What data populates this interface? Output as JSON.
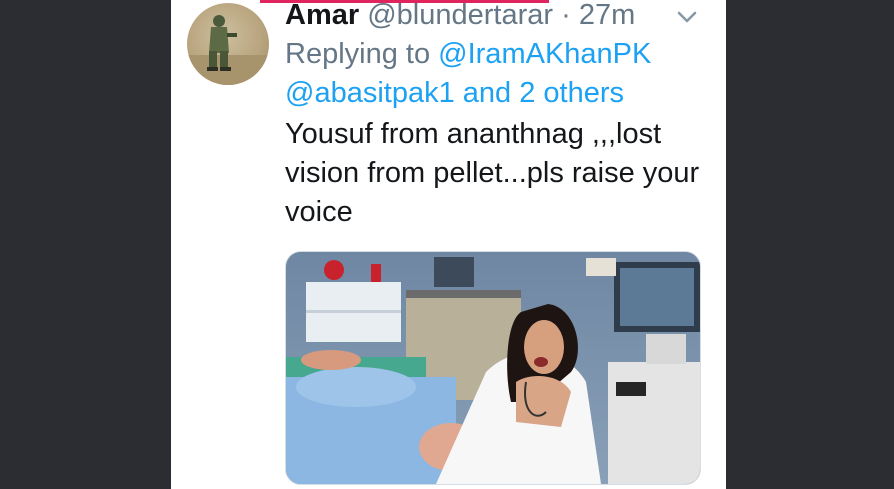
{
  "tweet": {
    "author_name": "Amar",
    "handle": "@blundertarar",
    "separator": "·",
    "timestamp": "27m",
    "reply_prefix": "Replying to",
    "reply_to_1": "@IramAKhanPK",
    "reply_to_2": "@abasitpak1",
    "reply_and": "and",
    "reply_others": "2 others",
    "text": "Yousuf from ananthnag ,,,lost vision from pellet...pls raise your voice"
  },
  "icons": {
    "avatar": "avatar-soldier-photo",
    "menu": "chevron-down-icon"
  },
  "colors": {
    "background": "#2b2d33",
    "card": "#ffffff",
    "link": "#1da1f2",
    "muted": "#657786",
    "text": "#14171a",
    "accent_bar": "#e0245e"
  }
}
